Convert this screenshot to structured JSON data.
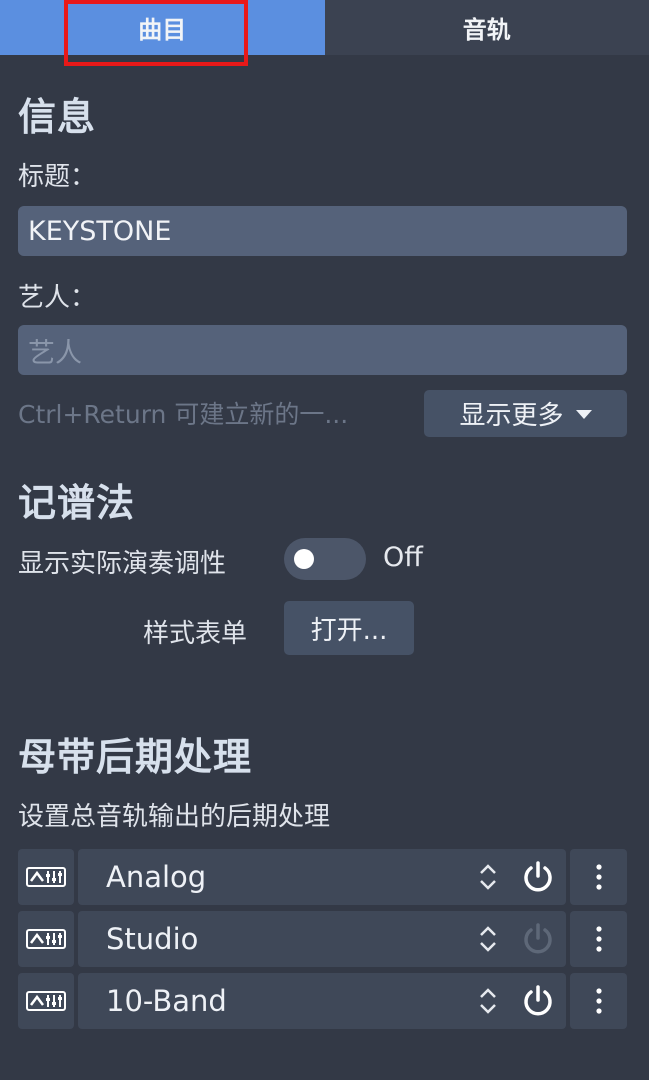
{
  "tabs": [
    {
      "label": "曲目",
      "active": true
    },
    {
      "label": "音轨",
      "active": false
    }
  ],
  "info": {
    "heading": "信息",
    "title_label": "标题：",
    "title_value": "KEYSTONE",
    "artist_label": "艺人：",
    "artist_placeholder": "艺人",
    "hint": "Ctrl+Return 可建立新的一...",
    "show_more_label": "显示更多"
  },
  "notation": {
    "heading": "记谱法",
    "concert_pitch_label": "显示实际演奏调性",
    "concert_pitch_state": "Off",
    "style_sheet_label": "样式表单",
    "open_button_label": "打开..."
  },
  "mastering": {
    "heading": "母带后期处理",
    "description": "设置总音轨输出的后期处理",
    "effects": [
      {
        "name": "Analog",
        "enabled": true
      },
      {
        "name": "Studio",
        "enabled": false
      },
      {
        "name": "10-Band",
        "enabled": true
      }
    ]
  },
  "colors": {
    "active_tab": "#5b8fe0",
    "highlight": "#e81919",
    "background": "#333946",
    "field": "#55627a"
  }
}
